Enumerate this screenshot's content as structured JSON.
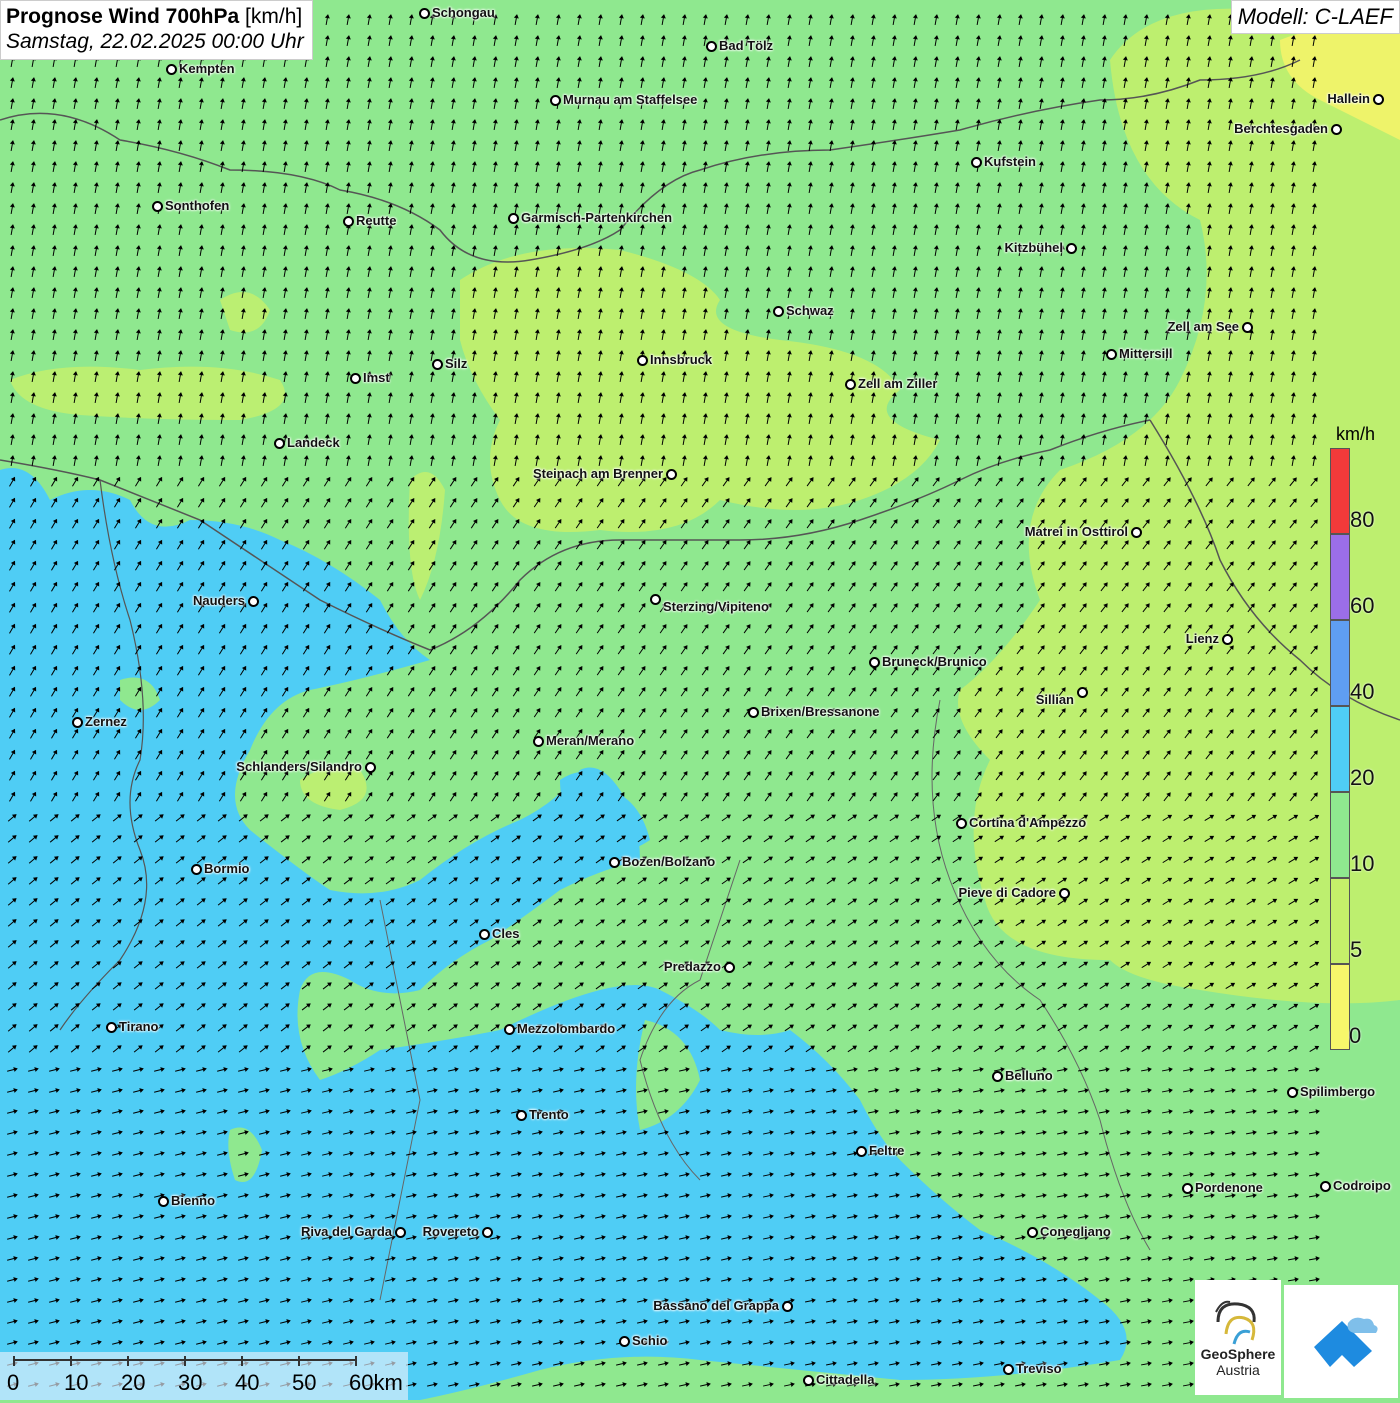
{
  "title": {
    "main_bold": "Prognose Wind 700hPa",
    "main_unit": " [km/h]",
    "subtitle": "Samstag, 22.02.2025 00:00 Uhr"
  },
  "model": "Modell: C-LAEF",
  "legend": {
    "unit": "km/h",
    "ticks": [
      "0",
      "5",
      "10",
      "20",
      "40",
      "60",
      "80"
    ],
    "colors": [
      "#f7f76b",
      "#c5f06a",
      "#8fe88f",
      "#4fcdf5",
      "#5f9ef2",
      "#9b6ee8",
      "#f23a3a"
    ]
  },
  "scale": {
    "labels": [
      "0",
      "10",
      "20",
      "30",
      "40",
      "50",
      "60km"
    ]
  },
  "logos": {
    "geosphere_line1": "GeoSphere",
    "geosphere_line2": "Austria"
  },
  "cities": [
    {
      "name": "Schongau"
    },
    {
      "name": "Bad Tölz"
    },
    {
      "name": "Kempten"
    },
    {
      "name": "Murnau am Staffelsee"
    },
    {
      "name": "Hallein"
    },
    {
      "name": "Berchtesgaden"
    },
    {
      "name": "Kufstein"
    },
    {
      "name": "Sonthofen"
    },
    {
      "name": "Reutte"
    },
    {
      "name": "Garmisch-Partenkirchen"
    },
    {
      "name": "Kitzbühel"
    },
    {
      "name": "Schwaz"
    },
    {
      "name": "Zell am See"
    },
    {
      "name": "Mittersill"
    },
    {
      "name": "Innsbruck"
    },
    {
      "name": "Silz"
    },
    {
      "name": "Imst"
    },
    {
      "name": "Zell am Ziller"
    },
    {
      "name": "Landeck"
    },
    {
      "name": "Steinach am Brenner"
    },
    {
      "name": "Matrei in Osttirol"
    },
    {
      "name": "Nauders"
    },
    {
      "name": "Sterzing/Vipiteno"
    },
    {
      "name": "Lienz"
    },
    {
      "name": "Bruneck/Brunico"
    },
    {
      "name": "Sillian"
    },
    {
      "name": "Zernez"
    },
    {
      "name": "Brixen/Bressanone"
    },
    {
      "name": "Meran/Merano"
    },
    {
      "name": "Schlanders/Silandro"
    },
    {
      "name": "Cortina d'Ampezzo"
    },
    {
      "name": "Bozen/Bolzano"
    },
    {
      "name": "Bormio"
    },
    {
      "name": "Pieve di Cadore"
    },
    {
      "name": "Cles"
    },
    {
      "name": "Predazzo"
    },
    {
      "name": "Tirano"
    },
    {
      "name": "Mezzolombardo"
    },
    {
      "name": "Belluno"
    },
    {
      "name": "Spilimbergo"
    },
    {
      "name": "Trento"
    },
    {
      "name": "Feltre"
    },
    {
      "name": "Pordenone"
    },
    {
      "name": "Codroipo"
    },
    {
      "name": "Bienno"
    },
    {
      "name": "Riva del Garda"
    },
    {
      "name": "Rovereto"
    },
    {
      "name": "Conegliano"
    },
    {
      "name": "Bassano del Grappa"
    },
    {
      "name": "Schio"
    },
    {
      "name": "Treviso"
    },
    {
      "name": "Cittadella"
    }
  ]
}
